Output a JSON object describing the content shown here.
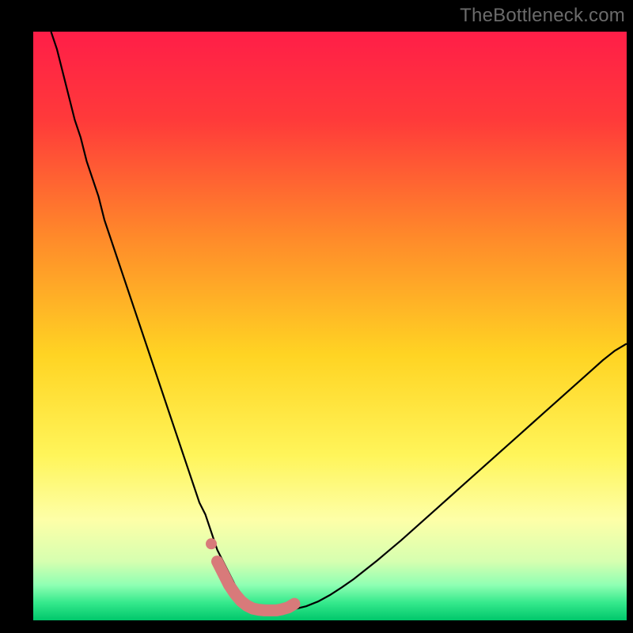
{
  "watermark": "TheBottleneck.com",
  "chart_data": {
    "type": "line",
    "title": "",
    "xlabel": "",
    "ylabel": "",
    "xlim": [
      0,
      100
    ],
    "ylim": [
      0,
      100
    ],
    "grid": false,
    "legend": false,
    "gradient_stops": [
      {
        "offset": 0.0,
        "color": "#ff1e48"
      },
      {
        "offset": 0.15,
        "color": "#ff3a3a"
      },
      {
        "offset": 0.35,
        "color": "#ff8a2a"
      },
      {
        "offset": 0.55,
        "color": "#ffd423"
      },
      {
        "offset": 0.72,
        "color": "#fff55a"
      },
      {
        "offset": 0.83,
        "color": "#fdffa8"
      },
      {
        "offset": 0.9,
        "color": "#d6ffb0"
      },
      {
        "offset": 0.94,
        "color": "#8fffb3"
      },
      {
        "offset": 0.97,
        "color": "#35e98c"
      },
      {
        "offset": 1.0,
        "color": "#00c76b"
      }
    ],
    "series": [
      {
        "name": "bottleneck-curve",
        "stroke": "#000000",
        "stroke_width": 2.2,
        "x": [
          3,
          4,
          5,
          6,
          7,
          8,
          9,
          10,
          11,
          12,
          13,
          14,
          15,
          16,
          17,
          18,
          19,
          20,
          21,
          22,
          23,
          24,
          25,
          26,
          27,
          28,
          29,
          30,
          31,
          32,
          33,
          34,
          35,
          36,
          37,
          38,
          39,
          40,
          42,
          44,
          46,
          48,
          50,
          52,
          54,
          56,
          58,
          60,
          62,
          64,
          66,
          68,
          70,
          72,
          74,
          76,
          78,
          80,
          82,
          84,
          86,
          88,
          90,
          92,
          94,
          96,
          98,
          100
        ],
        "y": [
          100,
          97,
          93,
          89,
          85,
          82,
          78,
          75,
          72,
          68,
          65,
          62,
          59,
          56,
          53,
          50,
          47,
          44,
          41,
          38,
          35,
          32,
          29,
          26,
          23,
          20,
          18,
          15,
          12,
          10,
          8,
          6,
          4.5,
          3.3,
          2.5,
          2.0,
          1.8,
          1.7,
          1.7,
          1.9,
          2.4,
          3.2,
          4.3,
          5.6,
          7.0,
          8.6,
          10.2,
          11.9,
          13.6,
          15.4,
          17.2,
          19.0,
          20.8,
          22.6,
          24.4,
          26.2,
          28.0,
          29.8,
          31.6,
          33.4,
          35.2,
          37.0,
          38.8,
          40.6,
          42.4,
          44.2,
          45.8,
          47.0
        ]
      },
      {
        "name": "highlight-band",
        "stroke": "#d87a7a",
        "stroke_width": 15,
        "linecap": "round",
        "x": [
          31,
          32,
          33,
          34,
          35,
          36,
          37,
          38,
          39,
          40,
          41,
          42,
          43,
          44
        ],
        "y": [
          10.0,
          8.0,
          6.0,
          4.5,
          3.3,
          2.5,
          2.0,
          1.8,
          1.7,
          1.7,
          1.7,
          1.9,
          2.2,
          2.8
        ]
      }
    ],
    "markers": [
      {
        "name": "highlight-dot",
        "x": 30,
        "y": 13,
        "r": 7,
        "fill": "#d87a7a"
      }
    ]
  }
}
